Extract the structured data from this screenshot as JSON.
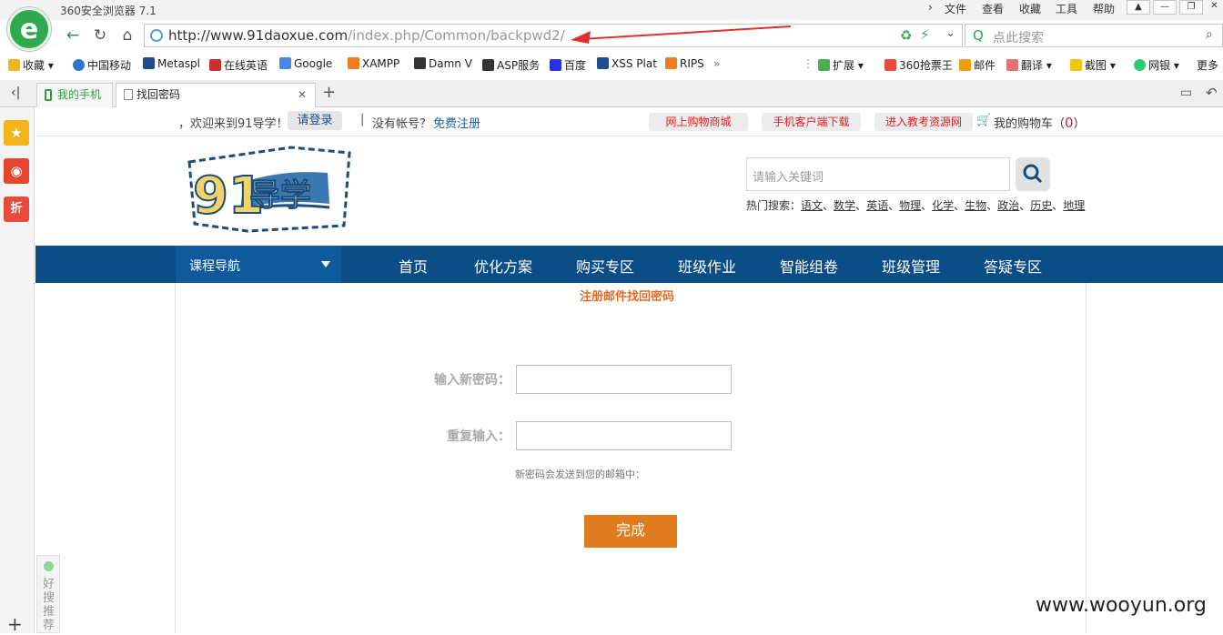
{
  "browser": {
    "app_title": "360安全浏览器 7.1",
    "menu": [
      "文件",
      "查看",
      "收藏",
      "工具",
      "帮助"
    ],
    "url_domain": "http://www.91daoxue.com",
    "url_path": "/index.php/Common/backpwd2/",
    "search_placeholder": "点此搜索",
    "bookmarks": [
      "收藏",
      "中国移动",
      "Metaspl",
      "在线英语",
      "Google",
      "XAMPP",
      "Damn V",
      "ASP服务",
      "百度",
      "XSS Plat",
      "RIPS"
    ],
    "bookmarks_right": [
      "扩展",
      "360抢票王",
      "邮件",
      "翻译",
      "截图",
      "网银",
      "更多"
    ],
    "tabs": [
      "我的手机",
      "找回密码"
    ]
  },
  "sidebar": {
    "recommend": "好搜推荐"
  },
  "site": {
    "welcome": "，欢迎来到91导学！",
    "login": "请登录",
    "separator": "|",
    "no_account": "没有帐号？",
    "register": "免费注册",
    "top_buttons": [
      "网上购物商城",
      "手机客户端下载",
      "进入教考资源网"
    ],
    "cart_label": "我的购物车（",
    "cart_count": "0",
    "cart_close": "）",
    "search_placeholder": "请输入关键词",
    "hot_label": "热门搜索：",
    "hot_items": [
      "语文",
      "数学",
      "英语",
      "物理",
      "化学",
      "生物",
      "政治",
      "历史",
      "地理"
    ],
    "course_nav": "课程导航",
    "nav": [
      "首页",
      "优化方案",
      "购买专区",
      "班级作业",
      "智能组卷",
      "班级管理",
      "答疑专区"
    ]
  },
  "form": {
    "heading": "注册邮件找回密码",
    "new_password_label": "输入新密码：",
    "repeat_label": "重复输入：",
    "hint": "新密码会发送到您的邮箱中：",
    "submit": "完成"
  },
  "watermark": "www.wooyun.org",
  "colors": {
    "nav_bg": "#0d4d86",
    "accent_orange": "#e07b1d",
    "heading_orange": "#e46c24",
    "red_text": "#e51c23"
  }
}
